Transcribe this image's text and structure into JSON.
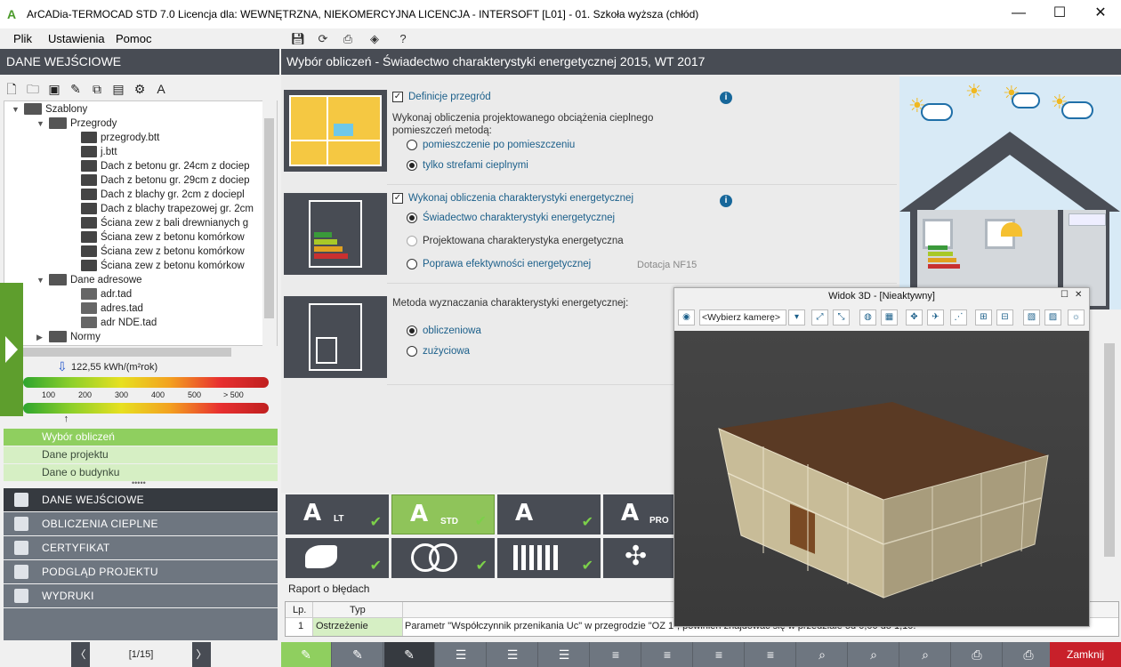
{
  "window": {
    "logo": "A",
    "title": "ArCADia-TERMOCAD STD 7.0 Licencja dla: WEWNĘTRZNA, NIEKOMERCYJNA LICENCJA - INTERSOFT [L01] - 01. Szkoła wyższa (chłód)",
    "minimize": "—",
    "maximize": "☐",
    "close": "✕"
  },
  "menu": [
    "Plik",
    "Ustawienia",
    "Pomoc"
  ],
  "left": {
    "header": "DANE WEJŚCIOWE",
    "tree": [
      {
        "label": "Szablony",
        "level": 0,
        "type": "folder"
      },
      {
        "label": "Przegrody",
        "level": 1,
        "type": "folder"
      },
      {
        "label": "przegrody.btt",
        "level": 2,
        "type": "doc"
      },
      {
        "label": "j.btt",
        "level": 2,
        "type": "doc"
      },
      {
        "label": "Dach z betonu gr. 24cm z dociep",
        "level": 2,
        "type": "doc"
      },
      {
        "label": "Dach z betonu gr. 29cm z dociep",
        "level": 2,
        "type": "doc"
      },
      {
        "label": "Dach z blachy gr. 2cm z dociepl",
        "level": 2,
        "type": "doc"
      },
      {
        "label": "Dach z blachy trapezowej gr. 2cm",
        "level": 2,
        "type": "doc"
      },
      {
        "label": "Ściana zew z bali drewnianych g",
        "level": 2,
        "type": "doc"
      },
      {
        "label": "Ściana zew z betonu komórkow",
        "level": 2,
        "type": "doc"
      },
      {
        "label": "Ściana zew z betonu komórkow",
        "level": 2,
        "type": "doc"
      },
      {
        "label": "Ściana zew z betonu komórkow",
        "level": 2,
        "type": "doc"
      },
      {
        "label": "Dane adresowe",
        "level": 1,
        "type": "folder"
      },
      {
        "label": "adr.tad",
        "level": 2,
        "type": "doc"
      },
      {
        "label": "adres.tad",
        "level": 2,
        "type": "doc"
      },
      {
        "label": "adr NDE.tad",
        "level": 2,
        "type": "doc"
      },
      {
        "label": "Normy",
        "level": 1,
        "type": "folder"
      }
    ],
    "energy_value": "122,55 kWh/(m²rok)",
    "scale_ticks": [
      "100",
      "200",
      "300",
      "400",
      "500",
      "> 500"
    ],
    "marker_fraction": 0.18,
    "subnav": [
      "Wybór obliczeń",
      "Dane projektu",
      "Dane o budynku"
    ],
    "subnav_more": "•••••",
    "mainnav": [
      "DANE WEJŚCIOWE",
      "OBLICZENIA CIEPLNE",
      "CERTYFIKAT",
      "PODGLĄD PROJEKTU",
      "WYDRUKI"
    ],
    "pager": {
      "prev": "〈",
      "label": "[1/15]",
      "next": "〉"
    }
  },
  "main": {
    "header": "Wybór obliczeń - Świadectwo charakterystyki energetycznej 2015, WT 2017",
    "s1": {
      "check_label": "Definicje przegród",
      "desc": "Wykonaj obliczenia projektowanego obciążenia cieplnego pomieszczeń metodą:",
      "opt1": "pomieszczenie po pomieszczeniu",
      "opt2": "tylko strefami cieplnymi"
    },
    "s2": {
      "check_label": "Wykonaj obliczenia charakterystyki energetycznej",
      "opt1": "Świadectwo charakterystyki energetycznej",
      "opt2": "Projektowana charakterystyka energetyczna",
      "opt3": "Poprawa efektywności energetycznej",
      "extra": "Dotacja NF15"
    },
    "s3": {
      "desc": "Metoda wyznaczania charakterystyki energetycznej:",
      "opt1": "obliczeniowa",
      "opt2": "zużyciowa"
    },
    "info_glyph": "i",
    "tiles": [
      {
        "label": "A",
        "sub": "LT",
        "checked": true,
        "active": false
      },
      {
        "label": "A",
        "sub": "STD",
        "checked": true,
        "active": true
      },
      {
        "label": "A",
        "sub": "",
        "checked": true,
        "active": false
      },
      {
        "label": "A",
        "sub": "PRO",
        "checked": false,
        "active": false
      }
    ],
    "check_mark": "✔",
    "report": {
      "label": "Raport o błędach",
      "columns": [
        "Lp.",
        "Typ"
      ],
      "row": {
        "lp": "1",
        "type": "Ostrzeżenie",
        "msg": "Parametr \"Współczynnik przenikania Uc\" w przegrodzie \"OZ 1\", powinien znajdować się w przedziale od 0,00 do 1,10."
      }
    },
    "close_button": "Zamknij"
  },
  "win3d": {
    "title": "Widok 3D - [Nieaktywny]",
    "camera": "<Wybierz kamerę>",
    "restore": "☐",
    "close": "✕"
  },
  "colors": {
    "dark": "#484c54",
    "green": "#5e9e2d",
    "accent": "#1b5f8a",
    "red": "#c8202a"
  }
}
